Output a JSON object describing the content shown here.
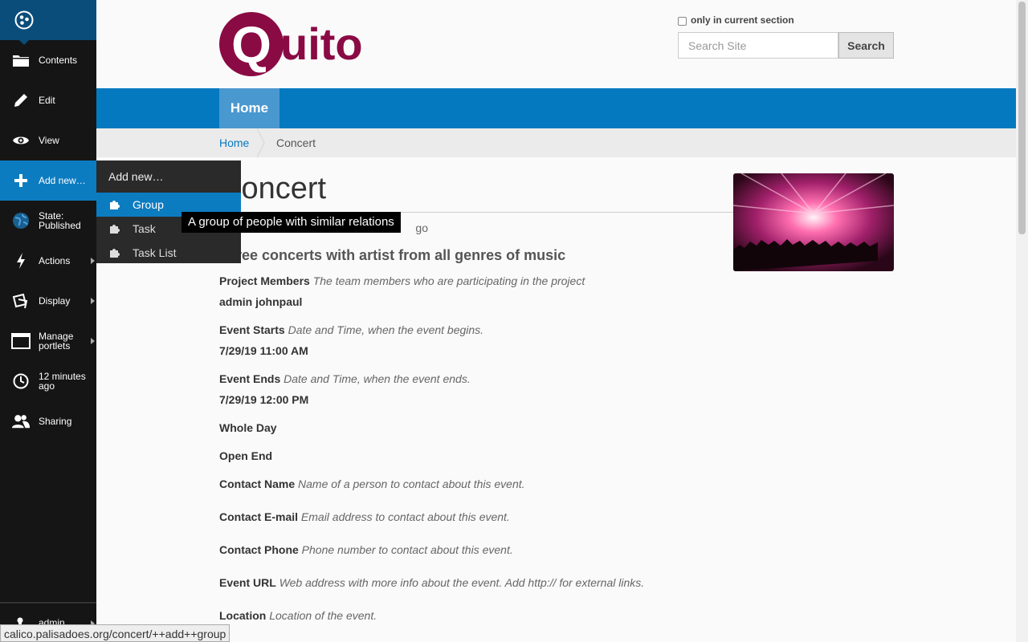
{
  "toolbar": {
    "items": [
      {
        "label": "Contents",
        "icon": "folder-icon"
      },
      {
        "label": "Edit",
        "icon": "pencil-icon"
      },
      {
        "label": "View",
        "icon": "eye-icon"
      },
      {
        "label": "Add new…",
        "icon": "plus-icon"
      },
      {
        "label": "State:\nPublished",
        "icon": "globe-icon"
      },
      {
        "label": "Actions",
        "icon": "bolt-icon"
      },
      {
        "label": "Display",
        "icon": "display-icon"
      },
      {
        "label": "Manage\nportlets",
        "icon": "portlet-icon"
      },
      {
        "label": "12 minutes\nago",
        "icon": "clock-icon"
      },
      {
        "label": "Sharing",
        "icon": "users-icon"
      }
    ],
    "user": "admin"
  },
  "add_menu": {
    "header": "Add new…",
    "items": [
      "Group",
      "Task",
      "Task List"
    ]
  },
  "tooltip": "A group of people with similar relations",
  "header": {
    "logo_text": "Quito",
    "checkbox_label": "only in current section",
    "search_placeholder": "Search Site",
    "search_button": "Search",
    "nav_home": "Home"
  },
  "breadcrumbs": [
    "Home",
    "Concert"
  ],
  "page": {
    "title": "Concert",
    "byline": "go",
    "description": "a free concerts with artist from all genres of music",
    "fields": [
      {
        "label": "Project Members",
        "help": "The team members who are participating in the project",
        "value": "admin johnpaul"
      },
      {
        "label": "Event Starts",
        "help": "Date and Time, when the event begins.",
        "value": "7/29/19 11:00 AM"
      },
      {
        "label": "Event Ends",
        "help": "Date and Time, when the event ends.",
        "value": "7/29/19 12:00 PM"
      },
      {
        "label": "Whole Day",
        "help": "",
        "value": ""
      },
      {
        "label": "Open End",
        "help": "",
        "value": ""
      },
      {
        "label": "Contact Name",
        "help": "Name of a person to contact about this event.",
        "value": ""
      },
      {
        "label": "Contact E-mail",
        "help": "Email address to contact about this event.",
        "value": ""
      },
      {
        "label": "Contact Phone",
        "help": "Phone number to contact about this event.",
        "value": ""
      },
      {
        "label": "Event URL",
        "help": "Web address with more info about the event. Add http:// for external links.",
        "value": ""
      },
      {
        "label": "Location",
        "help": "Location of the event.",
        "value": ""
      }
    ]
  },
  "status_url": "calico.palisadoes.org/concert/++add++group",
  "colors": {
    "toolbar": "#151515",
    "accent": "#0579bf",
    "logo": "#8a0a44"
  }
}
